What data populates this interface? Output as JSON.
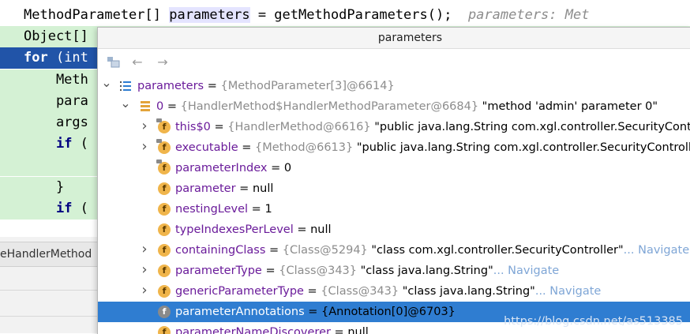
{
  "editor": {
    "lines": [
      {
        "segments": [
          {
            "t": "MethodParameter[] "
          },
          {
            "t": "parameters",
            "c": "hl-word"
          },
          {
            "t": " = getMethodParameters();  "
          },
          {
            "t": "parameters: Met",
            "c": "hint"
          }
        ]
      },
      {
        "segments": [
          {
            "t": "Object[]"
          }
        ]
      },
      {
        "segments": [
          {
            "t": "for",
            "c": "kw"
          },
          {
            "t": " (int"
          }
        ]
      },
      {
        "segments": [
          {
            "t": "    Meth"
          }
        ]
      },
      {
        "segments": [
          {
            "t": "    para"
          }
        ]
      },
      {
        "segments": [
          {
            "t": "    args"
          }
        ]
      },
      {
        "segments": [
          {
            "t": "    "
          },
          {
            "t": "if",
            "c": "kw"
          },
          {
            "t": " ("
          }
        ]
      },
      {
        "segments": [
          {
            "t": ""
          }
        ]
      },
      {
        "segments": [
          {
            "t": "    }"
          }
        ]
      },
      {
        "segments": [
          {
            "t": "    "
          },
          {
            "t": "if",
            "c": "kw"
          },
          {
            "t": " ("
          }
        ]
      }
    ],
    "tab_label": "eHandlerMethod"
  },
  "popup": {
    "title": "parameters",
    "toolbar": {
      "back_label": "←",
      "forward_label": "→"
    },
    "rows": [
      {
        "arrow": "down",
        "icon": "list",
        "name": "parameters",
        "eq": " = ",
        "ref": "{MethodParameter[3]@6614}",
        "val": "",
        "nav": ""
      },
      {
        "arrow": "down",
        "icon": "array",
        "name": "0",
        "eq": " = ",
        "ref": "{HandlerMethod$HandlerMethodParameter@6684}",
        "val": " \"method 'admin' parameter 0\"",
        "nav": ""
      },
      {
        "arrow": "right",
        "icon": "field-lock",
        "name": "this$0",
        "eq": " = ",
        "ref": "{HandlerMethod@6616}",
        "val": " \"public java.lang.String com.xgl.controller.SecurityContro",
        "nav": ""
      },
      {
        "arrow": "right",
        "icon": "field-lock",
        "name": "executable",
        "eq": " = ",
        "ref": "{Method@6613}",
        "val": " \"public java.lang.String com.xgl.controller.SecurityControll",
        "nav": ""
      },
      {
        "arrow": "",
        "icon": "field-lock",
        "name": "parameterIndex",
        "eq": " = ",
        "ref": "",
        "val": "0",
        "nav": ""
      },
      {
        "arrow": "",
        "icon": "field",
        "name": "parameter",
        "eq": " = ",
        "ref": "",
        "val": "null",
        "nav": ""
      },
      {
        "arrow": "",
        "icon": "field",
        "name": "nestingLevel",
        "eq": " = ",
        "ref": "",
        "val": "1",
        "nav": ""
      },
      {
        "arrow": "",
        "icon": "field",
        "name": "typeIndexesPerLevel",
        "eq": " = ",
        "ref": "",
        "val": "null",
        "nav": ""
      },
      {
        "arrow": "right",
        "icon": "field",
        "name": "containingClass",
        "eq": " = ",
        "ref": "{Class@5294}",
        "val": " \"class com.xgl.controller.SecurityController\"",
        "nav": "... Navigate"
      },
      {
        "arrow": "right",
        "icon": "field",
        "name": "parameterType",
        "eq": " = ",
        "ref": "{Class@343}",
        "val": " \"class java.lang.String\"",
        "nav": "... Navigate"
      },
      {
        "arrow": "right",
        "icon": "field",
        "name": "genericParameterType",
        "eq": " = ",
        "ref": "{Class@343}",
        "val": " \"class java.lang.String\"",
        "nav": "... Navigate"
      },
      {
        "arrow": "",
        "icon": "field",
        "name": "parameterAnnotations",
        "eq": " = ",
        "ref": "",
        "val": "{Annotation[0]@6703}",
        "nav": "",
        "selected": true
      },
      {
        "arrow": "",
        "icon": "field",
        "name": "parameterNameDiscoverer",
        "eq": " = ",
        "ref": "",
        "val": "null",
        "nav": ""
      }
    ]
  },
  "watermark": "https://blog.csdn.net/as513385",
  "colors": {
    "selection": "#2f7dd1",
    "editor_selection": "#2154a8",
    "field_icon": "#f0b54b",
    "field_name": "#6a1b9a"
  }
}
